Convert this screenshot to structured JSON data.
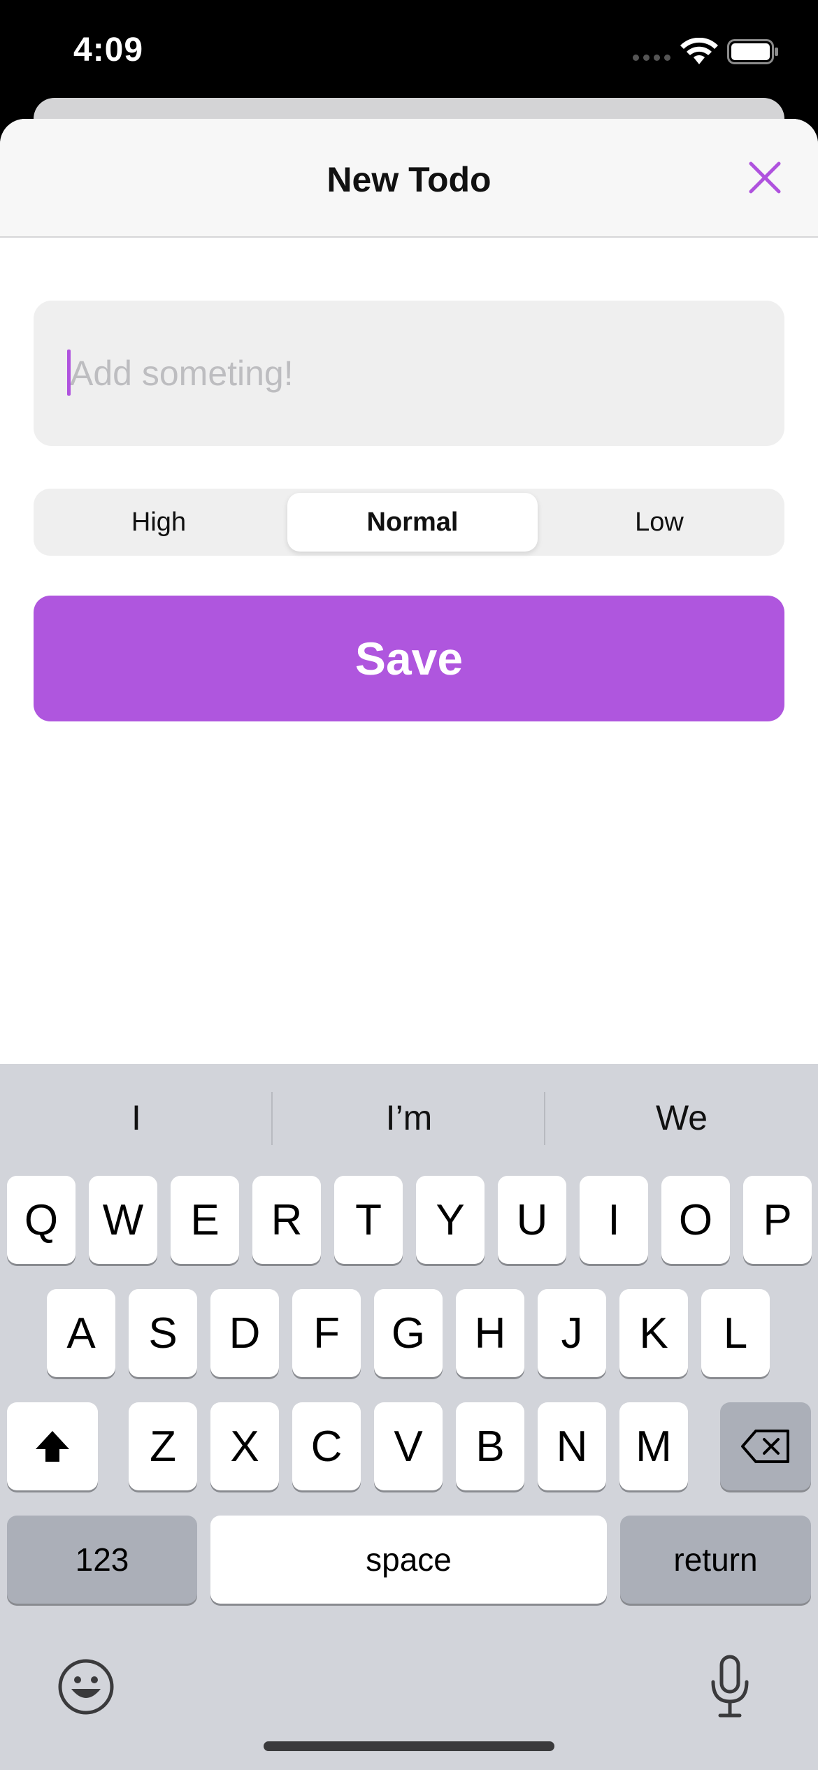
{
  "status_bar": {
    "time": "4:09"
  },
  "sheet": {
    "title": "New Todo",
    "input": {
      "value": "",
      "placeholder": "Add someting!"
    },
    "priority": {
      "options": [
        "High",
        "Normal",
        "Low"
      ],
      "selected": "Normal"
    },
    "save_label": "Save",
    "accent_color": "#af52de"
  },
  "keyboard": {
    "predictions": [
      "I",
      "I’m",
      "We"
    ],
    "row1": [
      "Q",
      "W",
      "E",
      "R",
      "T",
      "Y",
      "U",
      "I",
      "O",
      "P"
    ],
    "row2": [
      "A",
      "S",
      "D",
      "F",
      "G",
      "H",
      "J",
      "K",
      "L"
    ],
    "row3": [
      "Z",
      "X",
      "C",
      "V",
      "B",
      "N",
      "M"
    ],
    "numbers_label": "123",
    "space_label": "space",
    "return_label": "return"
  }
}
